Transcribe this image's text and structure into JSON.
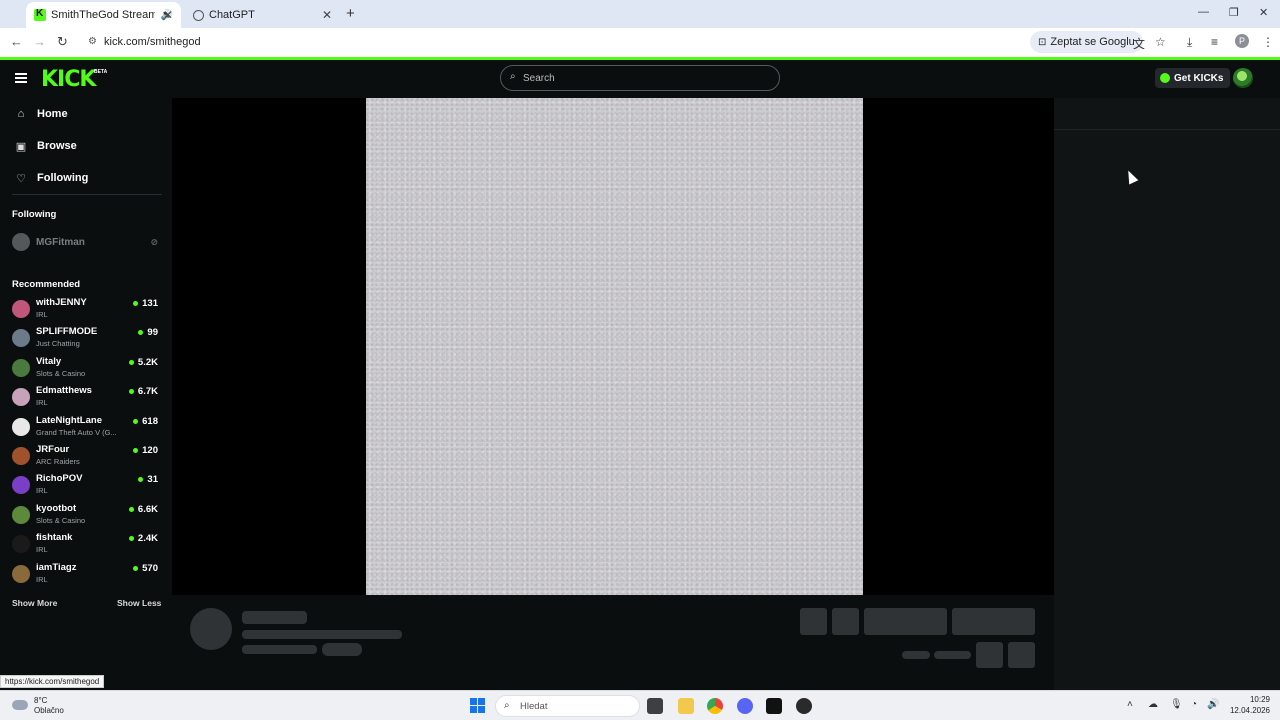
{
  "browser": {
    "tabs": [
      {
        "title": "SmithTheGod Stream - Watc",
        "active": true
      },
      {
        "title": "ChatGPT",
        "active": false
      }
    ],
    "url": "kick.com/smithegod",
    "google_btn": "Zeptat se Googlu",
    "profile_letter": "P",
    "status_url": "https://kick.com/smithegod"
  },
  "header": {
    "logo": "KICK",
    "beta": "BETA",
    "search_placeholder": "Search",
    "get_kicks": "Get KICKs"
  },
  "sidebar": {
    "nav": [
      {
        "label": "Home",
        "icon": "home-icon"
      },
      {
        "label": "Browse",
        "icon": "browse-icon"
      },
      {
        "label": "Following",
        "icon": "heart-icon"
      }
    ],
    "following_heading": "Following",
    "following": [
      {
        "name": "MGFitman",
        "status": "offline"
      }
    ],
    "recommended_heading": "Recommended",
    "recommended": [
      {
        "name": "withJENNY",
        "category": "IRL",
        "viewers": "131",
        "avatar_color": "#c0577a"
      },
      {
        "name": "SPLIFFMODE",
        "category": "Just Chatting",
        "viewers": "99",
        "avatar_color": "#6d7a8a"
      },
      {
        "name": "Vitaly",
        "category": "Slots & Casino",
        "viewers": "5.2K",
        "avatar_color": "#4b7a3e"
      },
      {
        "name": "Edmatthews",
        "category": "IRL",
        "viewers": "6.7K",
        "avatar_color": "#c7a2b8"
      },
      {
        "name": "LateNightLane",
        "category": "Grand Theft Auto V (G...",
        "viewers": "618",
        "avatar_color": "#e8e8e8"
      },
      {
        "name": "JRFour",
        "category": "ARC Raiders",
        "viewers": "120",
        "avatar_color": "#a0522d"
      },
      {
        "name": "RichoPOV",
        "category": "IRL",
        "viewers": "31",
        "avatar_color": "#7a3ec7"
      },
      {
        "name": "kyootbot",
        "category": "Slots & Casino",
        "viewers": "6.6K",
        "avatar_color": "#5d8a3a"
      },
      {
        "name": "fishtank",
        "category": "IRL",
        "viewers": "2.4K",
        "avatar_color": "#1a1a1a"
      },
      {
        "name": "iamTiagz",
        "category": "IRL",
        "viewers": "570",
        "avatar_color": "#8a6a3a"
      }
    ],
    "show_more": "Show More",
    "show_less": "Show Less"
  },
  "taskbar": {
    "weather_temp": "8°C",
    "weather_desc": "Oblačno",
    "search_placeholder": "Hledat",
    "time": "10:29",
    "date": "12.04.2026"
  },
  "colors": {
    "accent": "#53fc18",
    "background": "#0b0e0f"
  }
}
